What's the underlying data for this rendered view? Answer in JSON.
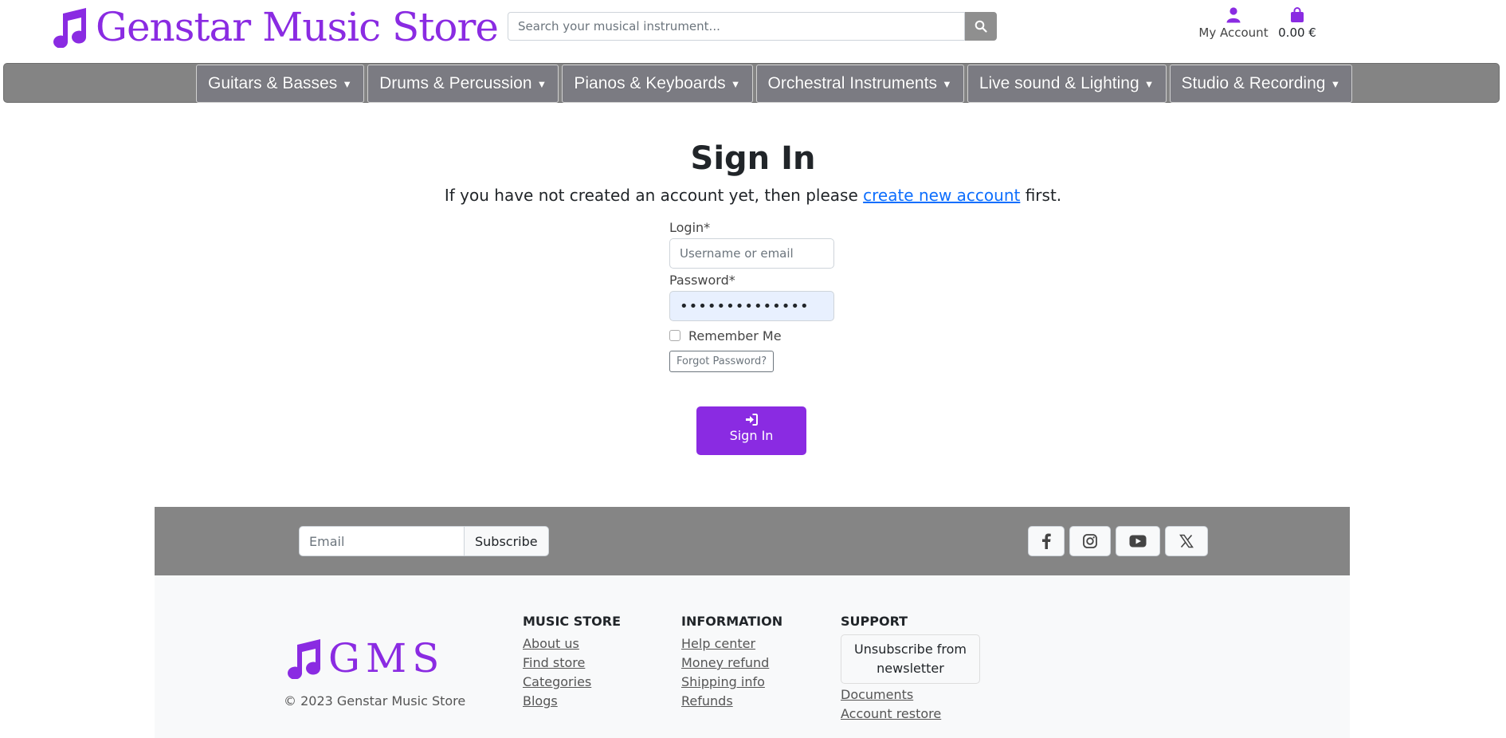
{
  "header": {
    "logo_text": "Genstar Music Store",
    "search_placeholder": "Search your musical instrument...",
    "account_label": "My Account",
    "cart_total": "0.00 €",
    "brand_color": "#8a2be2"
  },
  "nav": {
    "items": [
      {
        "label": "Guitars & Basses"
      },
      {
        "label": "Drums & Percussion"
      },
      {
        "label": "Pianos & Keyboards"
      },
      {
        "label": "Orchestral Instruments"
      },
      {
        "label": "Live sound & Lighting"
      },
      {
        "label": "Studio & Recording"
      }
    ]
  },
  "signin": {
    "title": "Sign In",
    "subtitle_before": "If you have not created an account yet, then please ",
    "create_link": "create new account",
    "subtitle_after": " first.",
    "login_label": "Login*",
    "login_placeholder": "Username or email",
    "password_label": "Password*",
    "password_value": "••••••••••••••",
    "remember_label": "Remember Me",
    "forgot_label": "Forgot Password?",
    "submit_label": "Sign In"
  },
  "footer": {
    "email_placeholder": "Email",
    "subscribe_label": "Subscribe",
    "socials": [
      "facebook-icon",
      "instagram-icon",
      "youtube-icon",
      "x-icon"
    ],
    "logo_text": "GMS",
    "copyright": "© 2023 Genstar Music Store",
    "music_store": {
      "heading": "MUSIC STORE",
      "links": [
        "About us",
        "Find store",
        "Categories",
        "Blogs"
      ]
    },
    "information": {
      "heading": "INFORMATION",
      "links": [
        "Help center",
        "Money refund",
        "Shipping info",
        "Refunds"
      ]
    },
    "support": {
      "heading": "SUPPORT",
      "unsubscribe": "Unsubscribe from newsletter",
      "links": [
        "Documents",
        "Account restore"
      ]
    }
  }
}
